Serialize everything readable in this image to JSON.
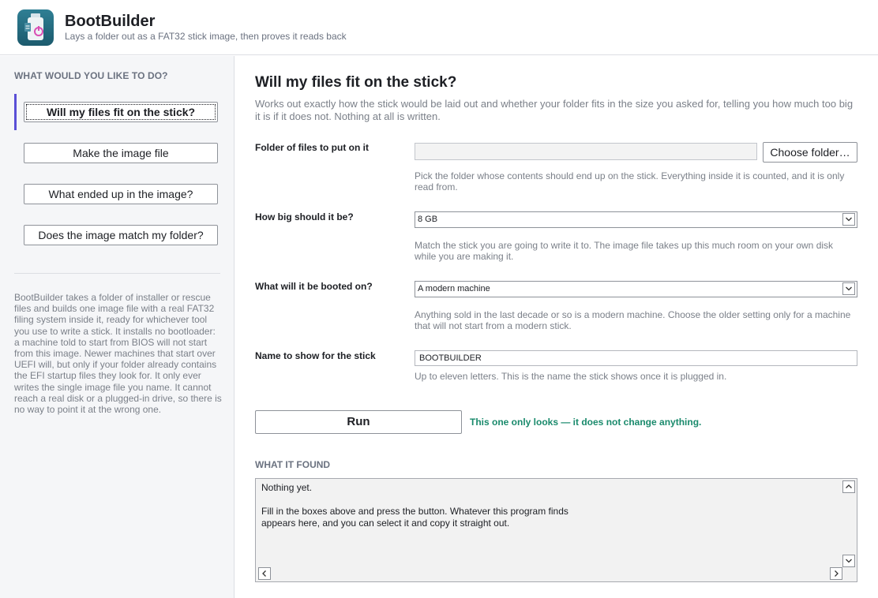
{
  "app": {
    "title": "BootBuilder",
    "subtitle": "Lays a folder out as a FAT32 stick image, then proves it reads back"
  },
  "sidebar": {
    "heading": "WHAT WOULD YOU LIKE TO DO?",
    "tasks": [
      {
        "label": "Will my files fit on the stick?",
        "active": true
      },
      {
        "label": "Make the image file",
        "active": false
      },
      {
        "label": "What ended up in the image?",
        "active": false
      },
      {
        "label": "Does the image match my folder?",
        "active": false
      }
    ],
    "note": "BootBuilder takes a folder of installer or rescue files and builds one image file with a real FAT32 filing system inside it, ready for whichever tool you use to write a stick. It installs no bootloader: a machine told to start from BIOS will not start from this image. Newer machines that start over UEFI will, but only if your folder already contains the EFI startup files they look for. It only ever writes the single image file you name. It cannot reach a real disk or a plugged-in drive, so there is no way to point it at the wrong one."
  },
  "main": {
    "title": "Will my files fit on the stick?",
    "description": "Works out exactly how the stick would be laid out and whether your folder fits in the size you asked for, telling you how much too big it is if it does not. Nothing at all is written.",
    "folder": {
      "label": "Folder of files to put on it",
      "value": "",
      "button": "Choose folder…",
      "help": "Pick the folder whose contents should end up on the stick. Everything inside it is counted, and it is only read from."
    },
    "size": {
      "label": "How big should it be?",
      "selected": "8 GB",
      "help": "Match the stick you are going to write it to. The image file takes up this much room on your own disk while you are making it."
    },
    "boot": {
      "label": "What will it be booted on?",
      "selected": "A modern machine",
      "help": "Anything sold in the last decade or so is a modern machine. Choose the older setting only for a machine that will not start from a modern stick."
    },
    "name": {
      "label": "Name to show for the stick",
      "value": "BOOTBUILDER",
      "help": "Up to eleven letters. This is the name the stick shows once it is plugged in."
    },
    "run": {
      "label": "Run",
      "note": "This one only looks — it does not change anything."
    },
    "output": {
      "heading": "WHAT IT FOUND",
      "text": "Nothing yet.\n\nFill in the boxes above and press the button. Whatever this program finds\nappears here, and you can select it and copy it straight out."
    }
  },
  "colors": {
    "accent": "#5a4fd6",
    "safe_note": "#1a8a6c",
    "logo": "#1c5a6d"
  },
  "icons": {
    "logo": "usb-stick-icon",
    "select_arrow": "chevron-down-icon",
    "scroll_up": "chevron-up-icon",
    "scroll_down": "chevron-down-icon",
    "scroll_left": "chevron-left-icon",
    "scroll_right": "chevron-right-icon"
  }
}
